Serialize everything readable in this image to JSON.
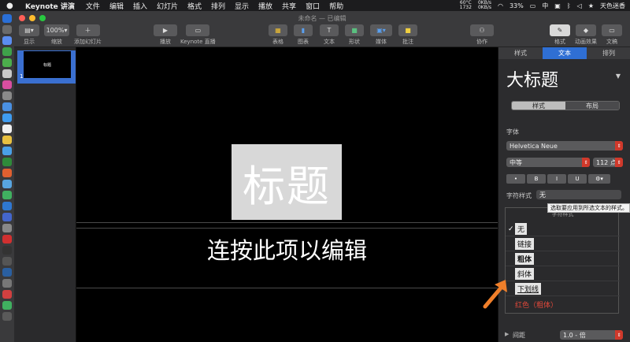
{
  "menubar": {
    "app": "Keynote 讲演",
    "items": [
      "文件",
      "编辑",
      "插入",
      "幻灯片",
      "格式",
      "排列",
      "显示",
      "播放",
      "共享",
      "窗口",
      "帮助"
    ],
    "status": {
      "temp": "60°C",
      "temp_sub": "1732",
      "net_up": "0KB/s",
      "net_down": "0KB/s",
      "battery": "33%",
      "input_method": "中",
      "user": "天色迷香"
    }
  },
  "window": {
    "title": "未命名 — 已编辑"
  },
  "toolbar": {
    "view_label": "显示",
    "zoom_value": "100%",
    "zoom_label": "缩放",
    "add_slide_label": "添加幻灯片",
    "play_label": "播放",
    "keynote_live_label": "Keynote 直播",
    "table_label": "表格",
    "chart_label": "图表",
    "text_label": "文本",
    "shape_label": "形状",
    "media_label": "媒体",
    "comment_label": "批注",
    "collaborate_label": "协作",
    "format_label": "格式",
    "animate_label": "动画效果",
    "document_label": "文稿"
  },
  "navigator": {
    "slide_number": "1",
    "thumb_title": "标题"
  },
  "slide": {
    "title": "标题",
    "subtitle": "连按此项以编辑"
  },
  "inspector": {
    "tabs": [
      "样式",
      "文本",
      "排列"
    ],
    "active_tab": "文本",
    "paragraph_style": "大标题",
    "segments": [
      "样式",
      "布局"
    ],
    "font_section": "字体",
    "font_name": "Helvetica Neue",
    "font_weight": "中等",
    "font_size": "112 点",
    "format_buttons": [
      "•",
      "B",
      "I",
      "U",
      "⚙▾"
    ],
    "char_style_label": "字符样式",
    "char_style_value": "无",
    "spacing_label": "间距",
    "spacing_value": "1.0 - 倍"
  },
  "char_style_menu": {
    "tooltip": "选取要应用到所选文本的样式。",
    "header": "字符样式",
    "items": [
      "无",
      "链接",
      "粗体",
      "斜体",
      "下划线",
      "红色（粗体）"
    ],
    "checked_item": "无"
  },
  "colors": {
    "accent": "#2f6fd4",
    "red": "#d0392b",
    "arrow": "#f07f2a"
  }
}
